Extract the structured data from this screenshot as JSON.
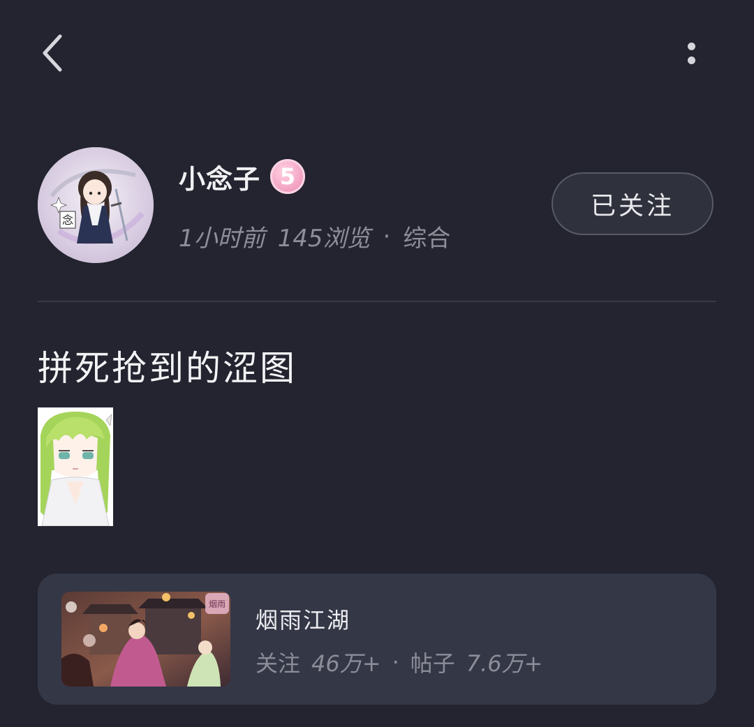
{
  "nav": {
    "back_icon": "chevron-left-icon",
    "more_icon": "more-vertical-icon"
  },
  "author": {
    "name": "小念子",
    "level": "5",
    "time": "1小时前",
    "views": "145浏览",
    "separator": "·",
    "category": "综合",
    "avatar_char": "念",
    "follow_label": "已关注"
  },
  "post": {
    "title": "拼死抢到的涩图"
  },
  "forum": {
    "name": "烟雨江湖",
    "followers_label": "关注",
    "followers_value": "46万+",
    "separator": "·",
    "posts_label": "帖子",
    "posts_value": "7.6万+",
    "thumb_text": "烟雨"
  },
  "colors": {
    "background": "#23242f",
    "card": "#343746",
    "level_badge": "#f4a7c5",
    "muted_text": "#8e8e99"
  }
}
